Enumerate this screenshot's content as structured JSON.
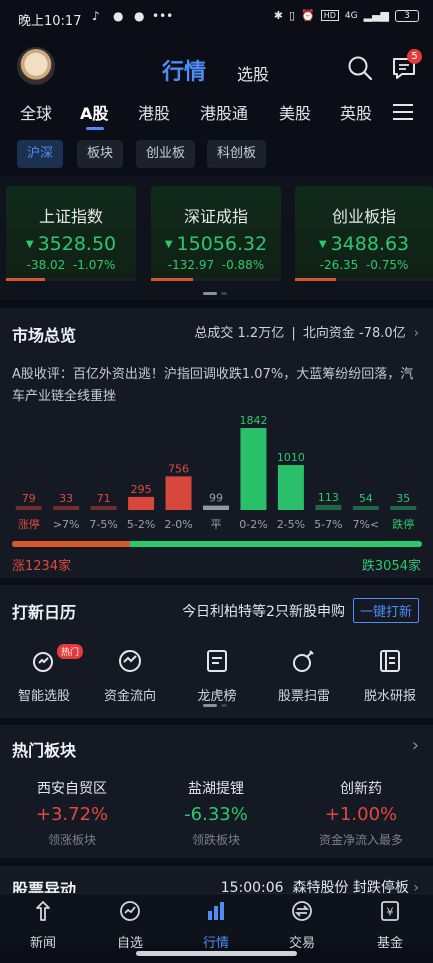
{
  "status_bar": {
    "time": "晚上10:17",
    "signal": "4G",
    "battery": "3",
    "hd": "HD"
  },
  "header": {
    "title": "行情",
    "subtitle": "选股",
    "message_badge": "5"
  },
  "tabs": [
    {
      "label": "全球"
    },
    {
      "label": "A股",
      "active": true
    },
    {
      "label": "港股"
    },
    {
      "label": "港股通"
    },
    {
      "label": "美股"
    },
    {
      "label": "英股"
    }
  ],
  "subtabs": [
    {
      "label": "沪深",
      "active": true
    },
    {
      "label": "板块"
    },
    {
      "label": "创业板"
    },
    {
      "label": "科创板"
    }
  ],
  "indices": [
    {
      "name": "上证指数",
      "value": "3528.50",
      "change": "-38.02",
      "pct": "-1.07%",
      "up_ratio": 0.3
    },
    {
      "name": "深证成指",
      "value": "15056.32",
      "change": "-132.97",
      "pct": "-0.88%",
      "up_ratio": 0.32
    },
    {
      "name": "创业板指",
      "value": "3488.63",
      "change": "-26.35",
      "pct": "-0.75%",
      "up_ratio": 0.3
    }
  ],
  "market": {
    "title": "市场总览",
    "turnover": "总成交 1.2万亿",
    "northbound": "北向资金 -78.0亿",
    "comment": "A股收评：百亿外资出逃！沪指回调收跌1.07%，大蓝筹纷纷回落，汽车产业链全线重挫",
    "up_label": "涨1234家",
    "down_label": "跌3054家",
    "up_ratio": 0.288
  },
  "chart_data": {
    "type": "bar",
    "categories": [
      "涨停",
      ">7%",
      "7-5%",
      "5-2%",
      "2-0%",
      "平",
      "0-2%",
      "2-5%",
      "5-7%",
      "7%<",
      "跌停"
    ],
    "values": [
      79,
      33,
      71,
      295,
      756,
      99,
      1842,
      1010,
      113,
      54,
      35
    ],
    "colors": [
      "#e14a3e",
      "#e14a3e",
      "#e14a3e",
      "#e14a3e",
      "#e14a3e",
      "#9aa0aa",
      "#2bc96e",
      "#2bc96e",
      "#2bc96e",
      "#2bc96e",
      "#2bc96e"
    ],
    "ylim": [
      0,
      1842
    ],
    "title": "",
    "xlabel": "",
    "ylabel": ""
  },
  "ipo": {
    "title": "打新日历",
    "info": "今日利柏特等2只新股申购",
    "button": "一键打新"
  },
  "tools": [
    {
      "label": "智能选股",
      "icon": "smart-stock-icon",
      "badge": "热门"
    },
    {
      "label": "资金流向",
      "icon": "capital-flow-icon"
    },
    {
      "label": "龙虎榜",
      "icon": "dragon-tiger-icon"
    },
    {
      "label": "股票扫雷",
      "icon": "mine-sweep-icon"
    },
    {
      "label": "脱水研报",
      "icon": "research-report-icon"
    }
  ],
  "hot_sectors": {
    "title": "热门板块",
    "items": [
      {
        "name": "西安自贸区",
        "pct": "+3.72%",
        "sub": "领涨板块",
        "color": "#e14a3e"
      },
      {
        "name": "盐湖提锂",
        "pct": "-6.33%",
        "sub": "领跌板块",
        "color": "#2bc96e"
      },
      {
        "name": "创新药",
        "pct": "+1.00%",
        "sub": "资金净流入最多",
        "color": "#e14a3e"
      }
    ]
  },
  "movers": {
    "title": "股票异动",
    "time": "15:00:06",
    "info": "森特股份 封跌停板"
  },
  "bottom_nav": [
    {
      "label": "新闻",
      "icon": "news-icon"
    },
    {
      "label": "自选",
      "icon": "watchlist-icon"
    },
    {
      "label": "行情",
      "icon": "market-icon",
      "active": true
    },
    {
      "label": "交易",
      "icon": "trade-icon"
    },
    {
      "label": "基金",
      "icon": "fund-icon"
    }
  ]
}
